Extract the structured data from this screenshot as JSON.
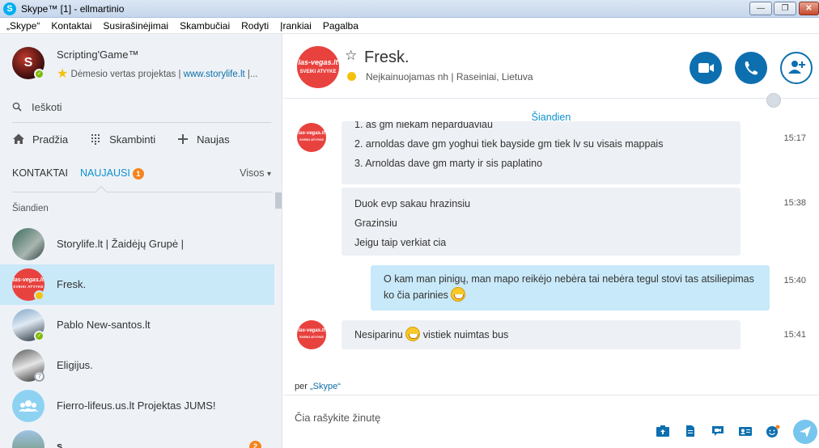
{
  "window": {
    "title": "Skype™ [1] - ellmartinio",
    "controls": [
      "minimize",
      "maximize",
      "close"
    ]
  },
  "menu": [
    "„Skype“",
    "Kontaktai",
    "Susirašinėjimai",
    "Skambučiai",
    "Rodyti",
    "Įrankiai",
    "Pagalba"
  ],
  "profile": {
    "name": "Scripting'Game™",
    "mood_prefix": "Dėmesio vertas projektas | ",
    "mood_link": "www.storylife.lt",
    "mood_suffix": " |..."
  },
  "search": {
    "placeholder": "Ieškoti"
  },
  "nav": {
    "home": "Pradžia",
    "call": "Skambinti",
    "new": "Naujas"
  },
  "tabs": {
    "contacts": "KONTAKTAI",
    "recent": "NAUJAUSI",
    "recent_badge": "1",
    "all": "Visos"
  },
  "section_today": "Šiandien",
  "conversations": [
    {
      "name": "Storylife.lt |  Žaidėjų Grupė |",
      "status": "",
      "badge": ""
    },
    {
      "name": "Fresk.",
      "status": "away",
      "badge": ""
    },
    {
      "name": "Pablo New-santos.lt",
      "status": "online",
      "badge": ""
    },
    {
      "name": "Eligijus.",
      "status": "unknown",
      "badge": ""
    },
    {
      "name": "Fierro-lifeus.us.lt Projektas JUMS!",
      "status": "",
      "badge": ""
    },
    {
      "name": "s",
      "status": "",
      "badge": "2"
    }
  ],
  "avatar_logo": {
    "top": "las-vegas.lt",
    "sub": "SVEIKI ATVYKE"
  },
  "header": {
    "name": "Fresk.",
    "status_text": "Neįkainuojamas nh  |  Raseiniai, Lietuva"
  },
  "chat": {
    "date": "Šiandien",
    "messages": [
      {
        "from": "them",
        "lines": [
          "1. as gm niekam neparduaviau",
          "2. arnoldas dave gm yoghui tiek bayside gm tiek lv su visais mappais",
          "3. Arnoldas dave gm marty ir sis paplatino"
        ],
        "time": "15:17"
      },
      {
        "from": "them",
        "lines": [
          "Duok evp sakau hrazinsiu",
          "Grazinsiu",
          "Jeigu taip verkiat cia"
        ],
        "time": "15:38"
      },
      {
        "from": "me",
        "text": "O kam man pinigų, man mapo reikėjo nebėra tai nebėra tegul stovi tas atsiliepimas ko čia parinies",
        "time": "15:40"
      },
      {
        "from": "them",
        "text_before": "Nesiparinu ",
        "text_after": " vistiek nuimtas bus",
        "time": "15:41"
      }
    ]
  },
  "via": {
    "prefix": "per ",
    "link": "„Skype“"
  },
  "composer": {
    "placeholder": "Čia rašykite žinutę"
  },
  "colors": {
    "accent": "#0d6fb0",
    "link": "#0e8fcf",
    "badge": "#f5841f",
    "online": "#7fba00",
    "selected": "#c9e8f8"
  }
}
